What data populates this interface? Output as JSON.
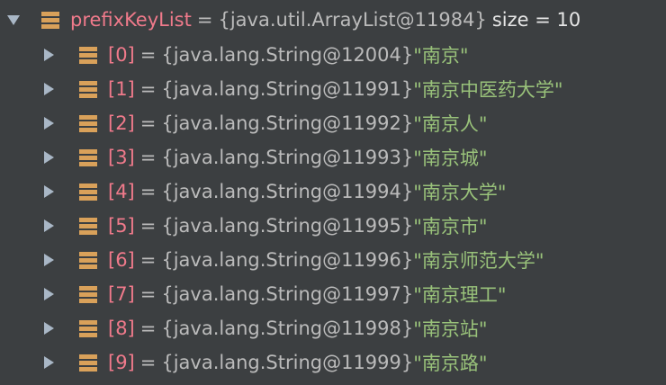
{
  "root": {
    "name": "prefixKeyList",
    "equals": "=",
    "value": "{java.util.ArrayList@11984}",
    "size": "size = 10"
  },
  "items": [
    {
      "index": "[0]",
      "ref": "{java.lang.String@12004}",
      "text": "\"南京\""
    },
    {
      "index": "[1]",
      "ref": "{java.lang.String@11991}",
      "text": "\"南京中医药大学\""
    },
    {
      "index": "[2]",
      "ref": "{java.lang.String@11992}",
      "text": "\"南京人\""
    },
    {
      "index": "[3]",
      "ref": "{java.lang.String@11993}",
      "text": "\"南京城\""
    },
    {
      "index": "[4]",
      "ref": "{java.lang.String@11994}",
      "text": "\"南京大学\""
    },
    {
      "index": "[5]",
      "ref": "{java.lang.String@11995}",
      "text": "\"南京市\""
    },
    {
      "index": "[6]",
      "ref": "{java.lang.String@11996}",
      "text": "\"南京师范大学\""
    },
    {
      "index": "[7]",
      "ref": "{java.lang.String@11997}",
      "text": "\"南京理工\""
    },
    {
      "index": "[8]",
      "ref": "{java.lang.String@11998}",
      "text": "\"南京站\""
    },
    {
      "index": "[9]",
      "ref": "{java.lang.String@11999}",
      "text": "\"南京路\""
    }
  ],
  "colors": {
    "background": "#3c3f41",
    "field_name": "#f07a8b",
    "string_value": "#99c27a",
    "field_icon": "#d9a15a"
  },
  "icons": {
    "expanded": "triangle-down",
    "collapsed": "triangle-right",
    "field": "field-stack"
  }
}
